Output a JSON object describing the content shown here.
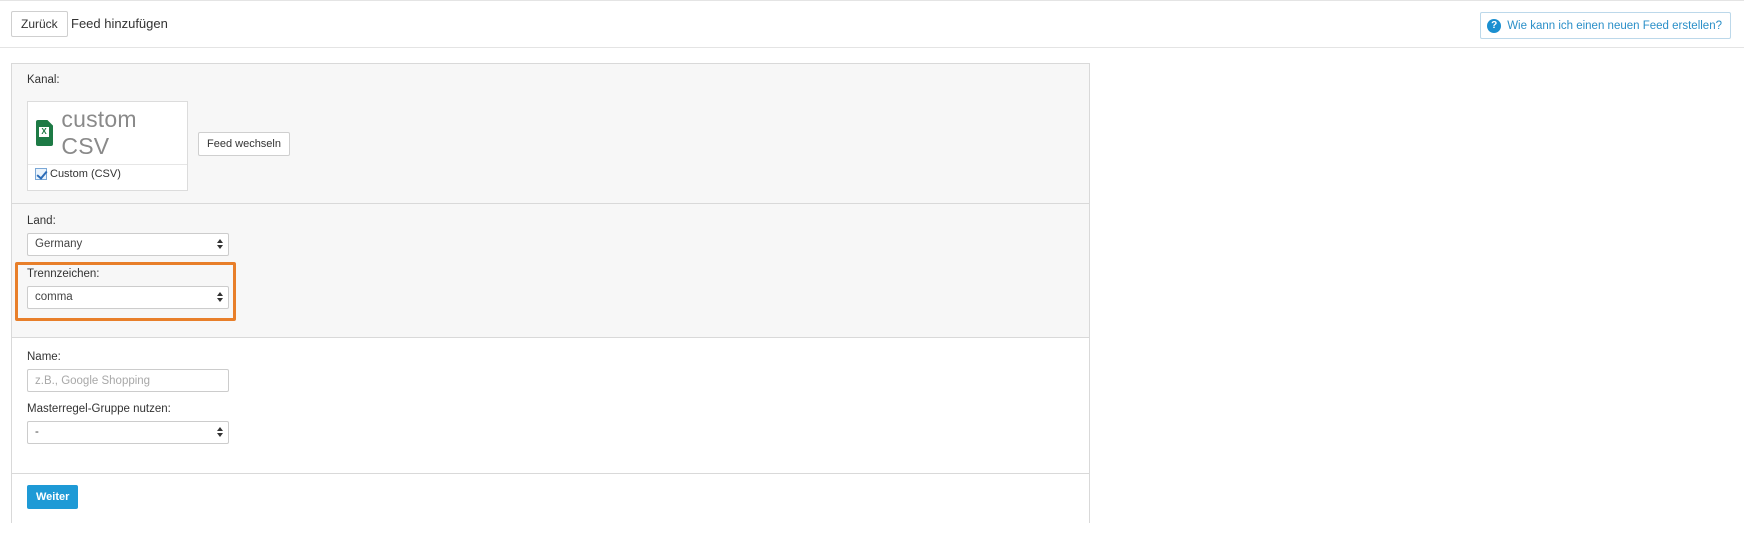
{
  "header": {
    "back_label": "Zurück",
    "title": "Feed hinzufügen",
    "help_label": "Wie kann ich einen neuen Feed erstellen?",
    "help_icon": "question-circle-icon"
  },
  "kanal": {
    "label": "Kanal:",
    "logo_text": "custom CSV",
    "logo_icon": "excel-csv-file-icon",
    "channel_name": "Custom (CSV)",
    "channel_checked": true,
    "switch_label": "Feed wechseln"
  },
  "land": {
    "label": "Land:",
    "selected": "Germany"
  },
  "trennzeichen": {
    "label": "Trennzeichen:",
    "selected": "comma",
    "highlight_color": "#e87f2a"
  },
  "name": {
    "label": "Name:",
    "placeholder": "z.B., Google Shopping",
    "value": ""
  },
  "masterregel": {
    "label": "Masterregel-Gruppe nutzen:",
    "selected": "-"
  },
  "footer": {
    "next_label": "Weiter"
  },
  "colors": {
    "primary": "#1e9ad6",
    "link": "#2a8fc8",
    "excel_green": "#1d7a45"
  }
}
